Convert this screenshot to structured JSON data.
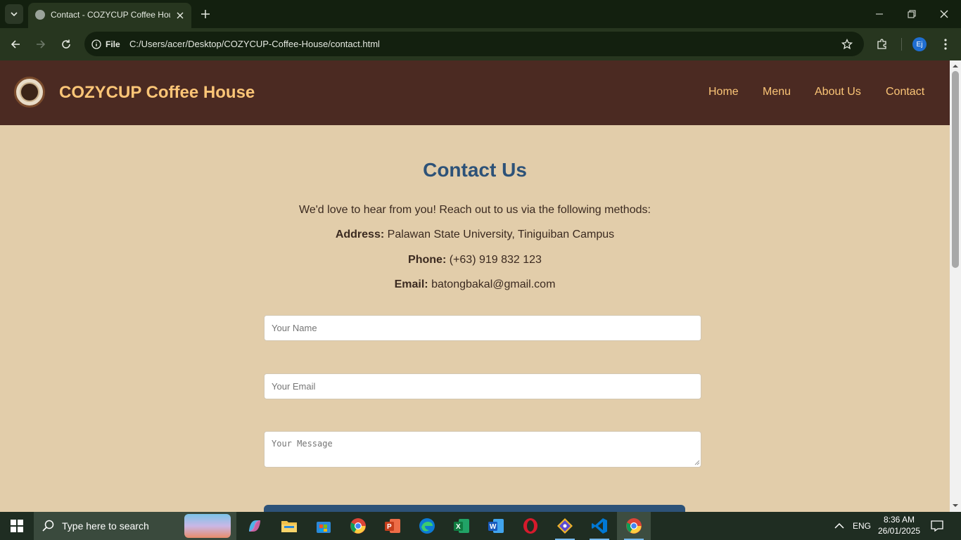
{
  "browser": {
    "tab_title": "Contact - COZYCUP Coffee House",
    "site_info_label": "File",
    "url": "C:/Users/acer/Desktop/COZYCUP-Coffee-House/contact.html",
    "profile_initials": "Ej"
  },
  "site": {
    "title": "COZYCUP Coffee House",
    "nav": [
      "Home",
      "Menu",
      "About Us",
      "Contact"
    ]
  },
  "contact": {
    "heading": "Contact Us",
    "intro": "We'd love to hear from you! Reach out to us via the following methods:",
    "address_label": "Address:",
    "address": "Palawan State University, Tiniguiban Campus",
    "phone_label": "Phone:",
    "phone": "(+63) 919 832 123",
    "email_label": "Email:",
    "email": "batongbakal@gmail.com",
    "form": {
      "name_placeholder": "Your Name",
      "email_placeholder": "Your Email",
      "message_placeholder": "Your Message"
    }
  },
  "taskbar": {
    "search_placeholder": "Type here to search",
    "language": "ENG",
    "time": "8:36 AM",
    "date": "26/01/2025",
    "apps": [
      "copilot",
      "file-explorer",
      "microsoft-store",
      "chrome",
      "powerpoint",
      "edge",
      "excel",
      "word",
      "opera",
      "git",
      "vscode",
      "chrome"
    ]
  },
  "colors": {
    "header_bg": "#4b2a22",
    "accent_text": "#fbc577",
    "page_bg": "#e2cdaa",
    "heading_blue": "#2d5278"
  }
}
